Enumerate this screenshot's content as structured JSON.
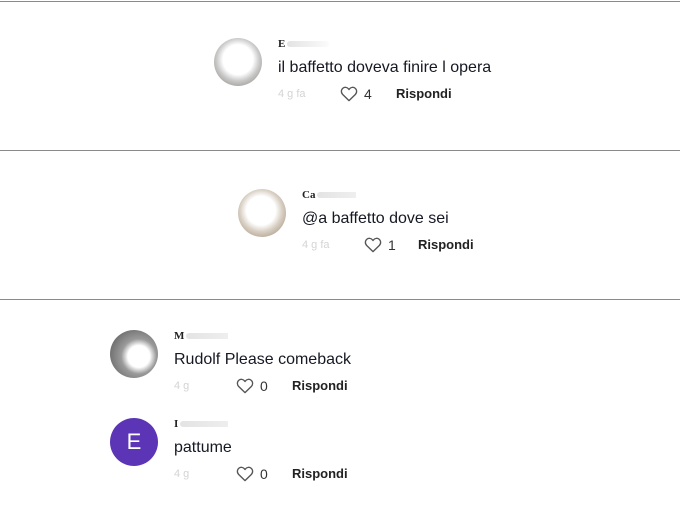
{
  "comments": [
    {
      "username": "E",
      "text": "il baffetto doveva finire l opera",
      "date": "4 g fa",
      "likes": "4",
      "reply_label": "Rispondi",
      "avatar": "photo"
    },
    {
      "username": "Ca",
      "text": "@a baffetto dove sei",
      "date": "4 g fa",
      "likes": "1",
      "reply_label": "Rispondi",
      "avatar": "photo"
    },
    {
      "username": "M",
      "text": "Rudolf Please comeback",
      "date": "4 g",
      "likes": "0",
      "reply_label": "Rispondi",
      "avatar": "photo"
    },
    {
      "username": "I",
      "text": "pattume",
      "date": "4 g",
      "likes": "0",
      "reply_label": "Rispondi",
      "avatar": "letter",
      "avatar_letter": "E",
      "avatar_color": "#5b35b5"
    }
  ],
  "icons": {
    "like": "heart-outline-icon"
  }
}
